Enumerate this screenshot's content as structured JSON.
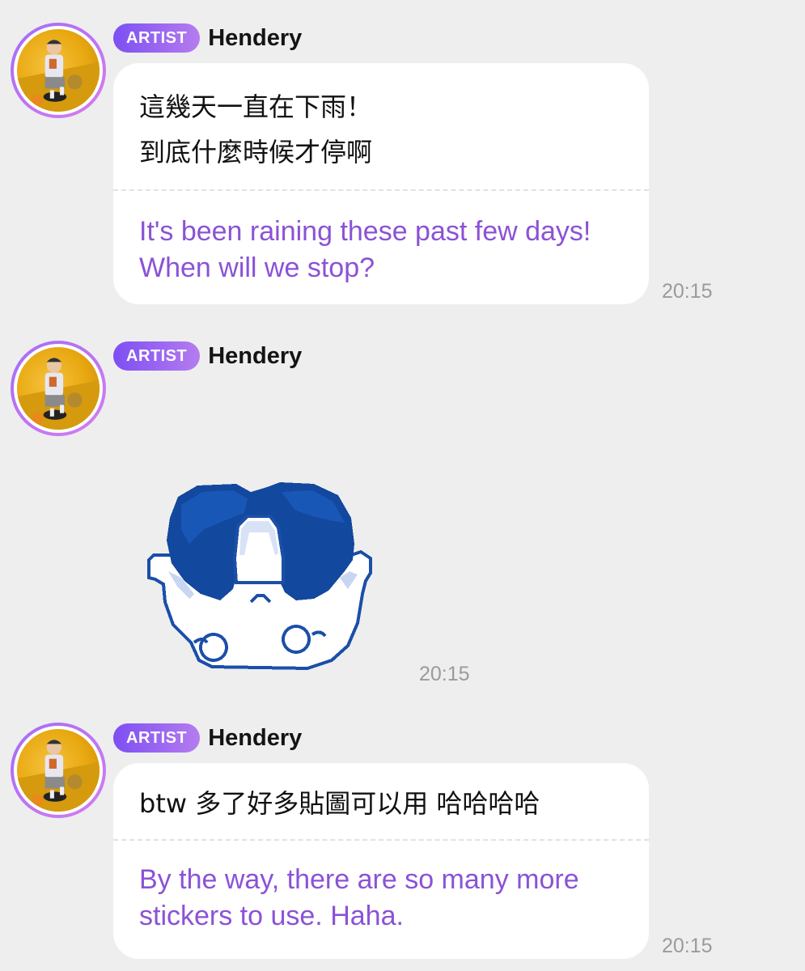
{
  "messages": [
    {
      "badge": "ARTIST",
      "sender": "Hendery",
      "original": "這幾天一直在下雨！\n到底什麼時候才停啊",
      "translation": "It's been raining these past few days! When will we stop?",
      "time": "20:15"
    },
    {
      "badge": "ARTIST",
      "sender": "Hendery",
      "sticker": "blue-haired-pixel-sticker",
      "time": "20:15"
    },
    {
      "badge": "ARTIST",
      "sender": "Hendery",
      "original": "btw 多了好多貼圖可以用 哈哈哈哈",
      "translation": "By the way, there are so many more stickers to use. Haha.",
      "time": "20:15"
    }
  ],
  "colors": {
    "background": "#eeeeef",
    "badge_gradient_start": "#7d4ff2",
    "badge_gradient_end": "#b57cf0",
    "translation_text": "#8b52d6",
    "timestamp": "#9b9b9b"
  }
}
